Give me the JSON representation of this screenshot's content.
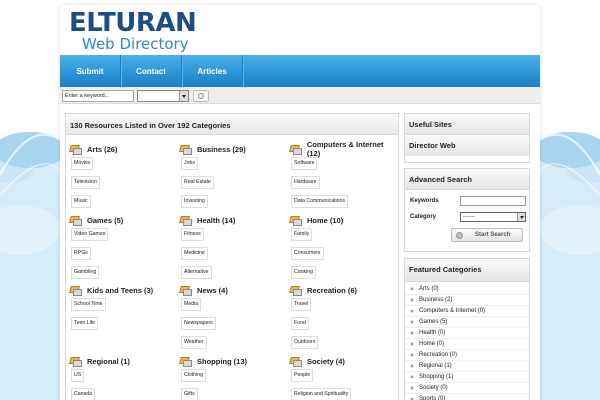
{
  "site": {
    "logo_line1": "ELTURAN",
    "logo_line2": "Web Directory"
  },
  "nav": {
    "items": [
      {
        "label": "Submit"
      },
      {
        "label": "Contact"
      },
      {
        "label": "Articles"
      }
    ]
  },
  "search": {
    "value": "Enter a keyword..."
  },
  "main": {
    "heading": "130 Resources Listed in Over 192 Categories",
    "categories": [
      {
        "title": "Arts (26)",
        "subs": [
          "Movies",
          "Television",
          "Music"
        ]
      },
      {
        "title": "Business (29)",
        "subs": [
          "Jobs",
          "Real Estate",
          "Investing"
        ]
      },
      {
        "title": "Computers & Internet (12)",
        "subs": [
          "Software",
          "Hardware",
          "Data Communications"
        ]
      },
      {
        "title": "Games (5)",
        "subs": [
          "Video Games",
          "RPGs",
          "Gambling"
        ]
      },
      {
        "title": "Health (14)",
        "subs": [
          "Fitness",
          "Medicine",
          "Alternative"
        ]
      },
      {
        "title": "Home (10)",
        "subs": [
          "Family",
          "Consumers",
          "Cooking"
        ]
      },
      {
        "title": "Kids and Teens (3)",
        "subs": [
          "School Time",
          "Teen Life"
        ]
      },
      {
        "title": "News (4)",
        "subs": [
          "Media",
          "Newspapers",
          "Weather"
        ]
      },
      {
        "title": "Recreation (6)",
        "subs": [
          "Travel",
          "Food",
          "Outdoors"
        ]
      },
      {
        "title": "Regional (1)",
        "subs": [
          "US",
          "Canada"
        ]
      },
      {
        "title": "Shopping (13)",
        "subs": [
          "Clothing",
          "Gifts"
        ]
      },
      {
        "title": "Society (4)",
        "subs": [
          "People",
          "Religion and Spirituality"
        ]
      }
    ]
  },
  "sidebar": {
    "useful_sites_heading": "Useful Sites",
    "useful_link": "Director Web",
    "advanced_search": {
      "heading": "Advanced Search",
      "keywords_label": "Keywords",
      "category_label": "Category",
      "category_value": "-------",
      "button_label": "Start Search"
    },
    "featured": {
      "heading": "Featured Categories",
      "items": [
        "Arts (0)",
        "Business (2)",
        "Computers & Internet (0)",
        "Games (5)",
        "Health (0)",
        "Home (0)",
        "Recreation (0)",
        "Regional (1)",
        "Shopping (1)",
        "Society (0)",
        "Sports (0)"
      ]
    }
  },
  "colors": {
    "nav_blue": "#2c94d8",
    "logo_dark": "#1c4d86",
    "logo_light": "#2a8ad0",
    "background": "#1e88c8"
  }
}
